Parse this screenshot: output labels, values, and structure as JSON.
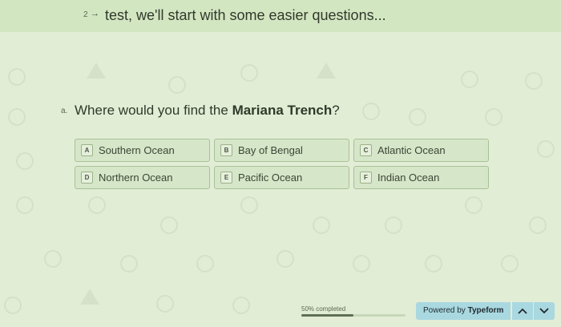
{
  "previous_question": {
    "number": "2",
    "arrow": "→",
    "text": "test, we'll start with some easier questions..."
  },
  "question": {
    "letter": "a.",
    "text_before": "Where would you find the ",
    "text_bold": "Mariana Trench",
    "text_after": "?"
  },
  "choices": [
    {
      "key": "A",
      "label": "Southern Ocean"
    },
    {
      "key": "B",
      "label": "Bay of Bengal"
    },
    {
      "key": "C",
      "label": "Atlantic Ocean"
    },
    {
      "key": "D",
      "label": "Northern Ocean"
    },
    {
      "key": "E",
      "label": "Pacific Ocean"
    },
    {
      "key": "F",
      "label": "Indian Ocean"
    }
  ],
  "progress": {
    "label": "50% completed",
    "fraction": 0.5
  },
  "footer": {
    "powered_prefix": "Powered by ",
    "powered_brand": "Typeform"
  },
  "colors": {
    "background": "#e2edd6",
    "accent_button": "#a9d8e0"
  }
}
